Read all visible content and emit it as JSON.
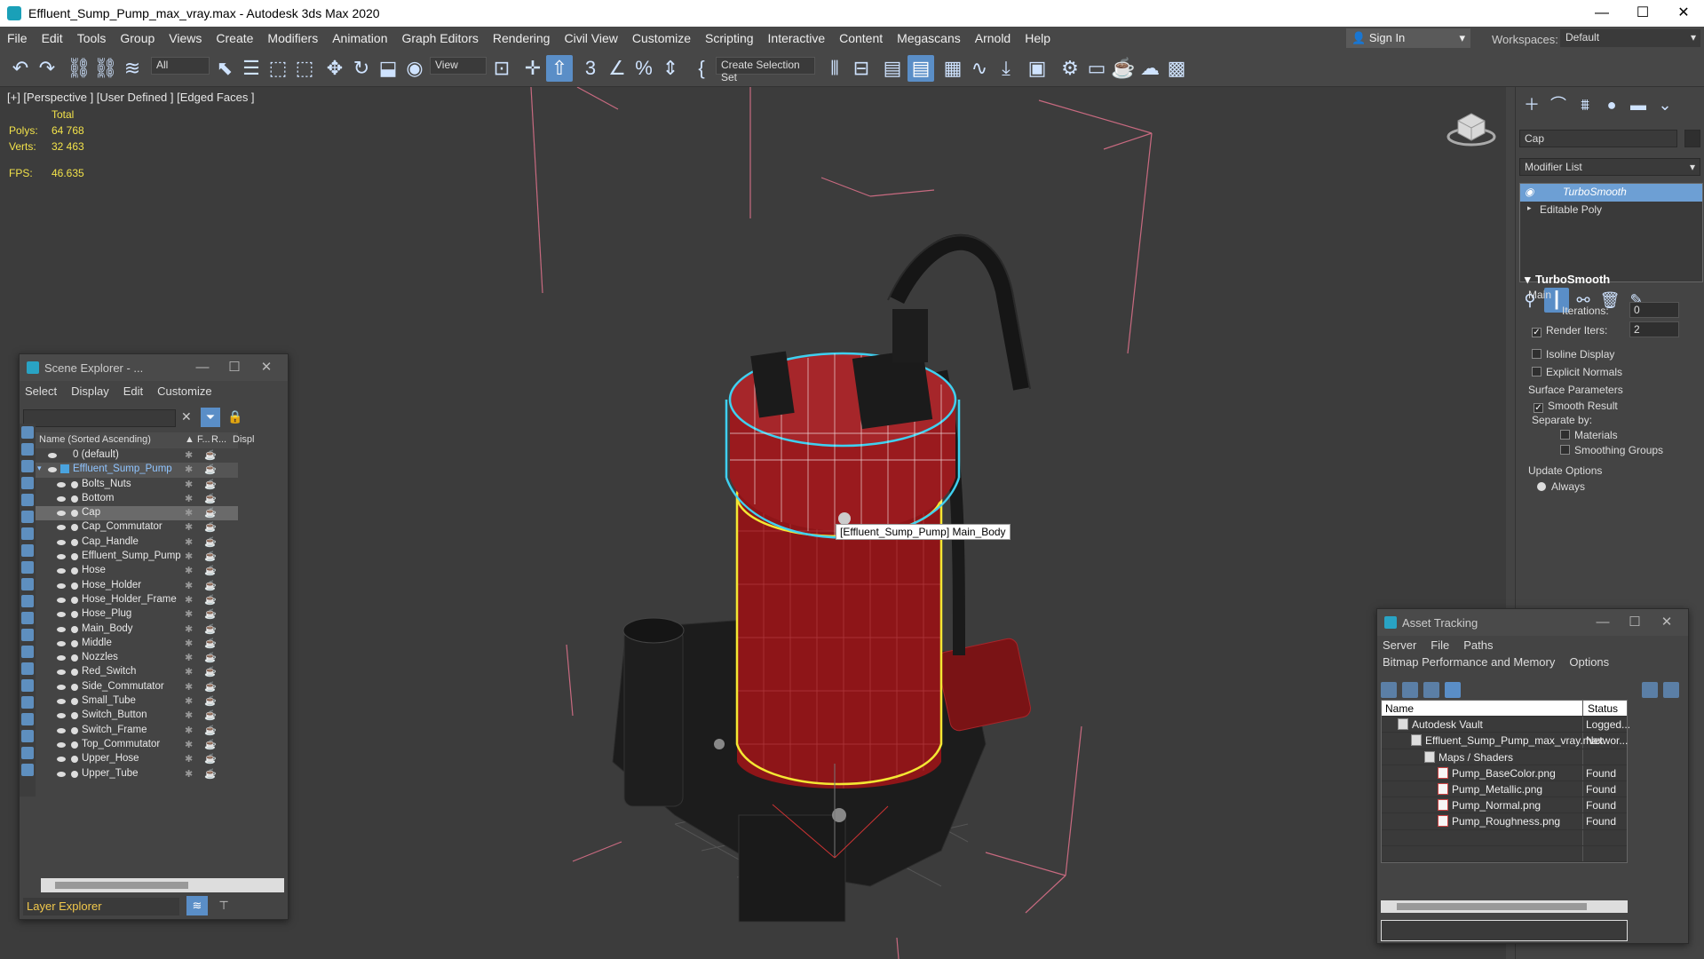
{
  "window": {
    "title": "Effluent_Sump_Pump_max_vray.max - Autodesk 3ds Max 2020",
    "minimize": "—",
    "maximize": "☐",
    "close": "✕"
  },
  "menu": [
    "File",
    "Edit",
    "Tools",
    "Group",
    "Views",
    "Create",
    "Modifiers",
    "Animation",
    "Graph Editors",
    "Rendering",
    "Civil View",
    "Customize",
    "Scripting",
    "Interactive",
    "Content",
    "Megascans",
    "Arnold",
    "Help"
  ],
  "account": {
    "sign_in": "Sign In",
    "workspaces_label": "Workspaces:",
    "workspace_value": "Default"
  },
  "toolbar": {
    "selection_filter": "All",
    "ref_coord": "View",
    "selection_set": "Create Selection Set"
  },
  "viewport": {
    "label": "[+] [Perspective ] [User Defined ] [Edged Faces ]",
    "stats_total": "Total",
    "polys_label": "Polys:",
    "polys_value": "64 768",
    "verts_label": "Verts:",
    "verts_value": "32 463",
    "fps_label": "FPS:",
    "fps_value": "46.635",
    "tooltip": "[Effluent_Sump_Pump] Main_Body",
    "colors": {
      "body_red": "#8e1518",
      "selection_cyan": "#3fd0f0",
      "highlight_yellow": "#f4e733",
      "bbox_pink": "#c86a80"
    }
  },
  "command_panel": {
    "object_name": "Cap",
    "modifier_list": "Modifier List",
    "stack": [
      "TurboSmooth",
      "Editable Poly"
    ],
    "rollout_title": "TurboSmooth",
    "main_label": "Main",
    "iterations_label": "Iterations:",
    "iterations_value": "0",
    "render_iters_label": "Render Iters:",
    "render_iters_value": "2",
    "isoline": "Isoline Display",
    "explicit_normals": "Explicit Normals",
    "surface_params": "Surface Parameters",
    "smooth_result": "Smooth Result",
    "separate_by": "Separate by:",
    "materials": "Materials",
    "smoothing_groups": "Smoothing Groups",
    "update_options": "Update Options",
    "always": "Always"
  },
  "scene_explorer": {
    "title": "Scene Explorer - ...",
    "menu": [
      "Select",
      "Display",
      "Edit",
      "Customize"
    ],
    "col_name": "Name (Sorted Ascending)",
    "col_f": "▲ F...",
    "col_r": "R...",
    "col_d": "Displ",
    "rows": [
      {
        "name": "0 (default)",
        "level": 0,
        "state": ""
      },
      {
        "name": "Effluent_Sump_Pump",
        "level": 0,
        "state": "layer"
      },
      {
        "name": "Bolts_Nuts",
        "level": 1,
        "state": ""
      },
      {
        "name": "Bottom",
        "level": 1,
        "state": ""
      },
      {
        "name": "Cap",
        "level": 1,
        "state": "sel"
      },
      {
        "name": "Cap_Commutator",
        "level": 1,
        "state": ""
      },
      {
        "name": "Cap_Handle",
        "level": 1,
        "state": ""
      },
      {
        "name": "Effluent_Sump_Pump",
        "level": 1,
        "state": ""
      },
      {
        "name": "Hose",
        "level": 1,
        "state": ""
      },
      {
        "name": "Hose_Holder",
        "level": 1,
        "state": ""
      },
      {
        "name": "Hose_Holder_Frame",
        "level": 1,
        "state": ""
      },
      {
        "name": "Hose_Plug",
        "level": 1,
        "state": ""
      },
      {
        "name": "Main_Body",
        "level": 1,
        "state": ""
      },
      {
        "name": "Middle",
        "level": 1,
        "state": ""
      },
      {
        "name": "Nozzles",
        "level": 1,
        "state": ""
      },
      {
        "name": "Red_Switch",
        "level": 1,
        "state": ""
      },
      {
        "name": "Side_Commutator",
        "level": 1,
        "state": ""
      },
      {
        "name": "Small_Tube",
        "level": 1,
        "state": ""
      },
      {
        "name": "Switch_Button",
        "level": 1,
        "state": ""
      },
      {
        "name": "Switch_Frame",
        "level": 1,
        "state": ""
      },
      {
        "name": "Top_Commutator",
        "level": 1,
        "state": ""
      },
      {
        "name": "Upper_Hose",
        "level": 1,
        "state": ""
      },
      {
        "name": "Upper_Tube",
        "level": 1,
        "state": ""
      }
    ],
    "footer": "Layer Explorer"
  },
  "asset_tracking": {
    "title": "Asset Tracking",
    "menu1": [
      "Server",
      "File",
      "Paths"
    ],
    "menu2": [
      "Bitmap Performance and Memory",
      "Options"
    ],
    "col_name": "Name",
    "col_status": "Status",
    "rows": [
      {
        "name": "Autodesk Vault",
        "status": "Logged...",
        "level": 0,
        "icon": "vault"
      },
      {
        "name": "Effluent_Sump_Pump_max_vray.max",
        "status": "Networ...",
        "level": 1,
        "icon": "max"
      },
      {
        "name": "Maps / Shaders",
        "status": "",
        "level": 2,
        "icon": "folder"
      },
      {
        "name": "Pump_BaseColor.png",
        "status": "Found",
        "level": 3,
        "icon": "png"
      },
      {
        "name": "Pump_Metallic.png",
        "status": "Found",
        "level": 3,
        "icon": "png"
      },
      {
        "name": "Pump_Normal.png",
        "status": "Found",
        "level": 3,
        "icon": "png"
      },
      {
        "name": "Pump_Roughness.png",
        "status": "Found",
        "level": 3,
        "icon": "png"
      }
    ]
  }
}
